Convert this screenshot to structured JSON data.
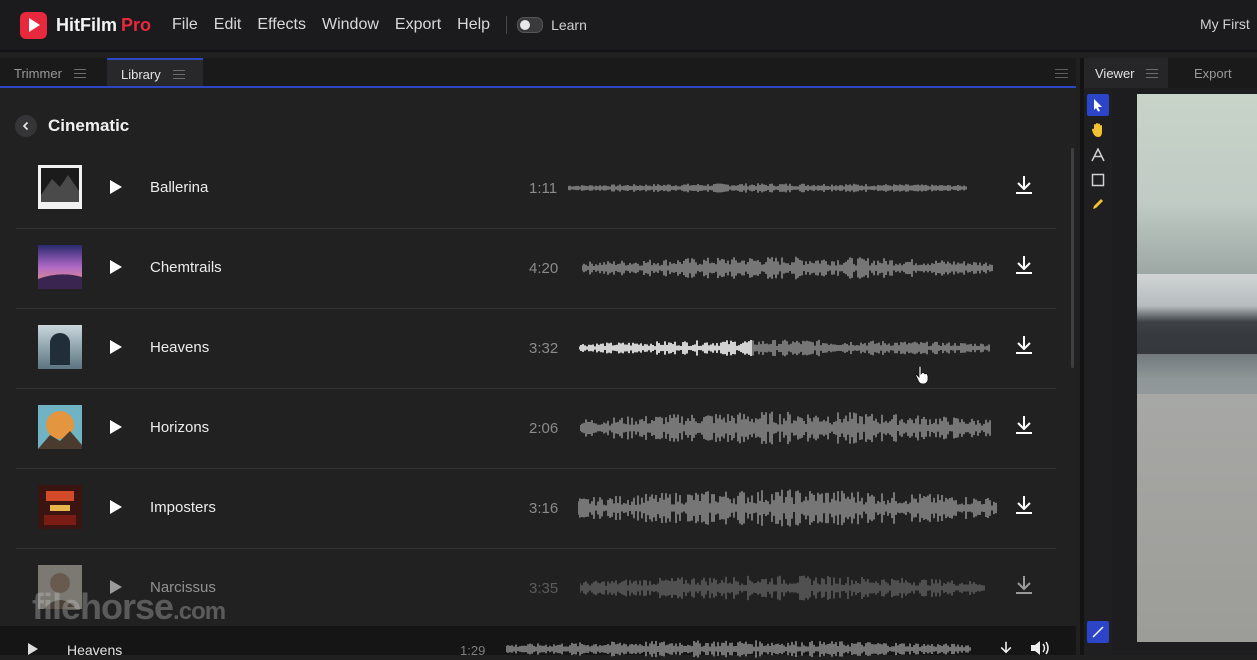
{
  "app": {
    "name": "HitFilm",
    "edition": "Pro",
    "brand_color": "#e8283d",
    "accent_color": "#2c47c4",
    "project_name": "My First"
  },
  "menu": {
    "items": [
      "File",
      "Edit",
      "Effects",
      "Window",
      "Export",
      "Help"
    ],
    "learn_label": "Learn",
    "learn_enabled": false
  },
  "left_panel": {
    "tabs": [
      {
        "label": "Trimmer",
        "active": false
      },
      {
        "label": "Library",
        "active": true
      }
    ],
    "category_title": "Cinematic",
    "tracks": [
      {
        "name": "Ballerina",
        "duration": "1:11",
        "cover": "dark-texture-cover"
      },
      {
        "name": "Chemtrails",
        "duration": "4:20",
        "cover": "purple-sunset-cover"
      },
      {
        "name": "Heavens",
        "duration": "3:32",
        "cover": "arch-portal-cover",
        "playing_progress": 0.42
      },
      {
        "name": "Horizons",
        "duration": "2:06",
        "cover": "moon-mountain-cover"
      },
      {
        "name": "Imposters",
        "duration": "3:16",
        "cover": "red-poster-cover"
      },
      {
        "name": "Narcissus",
        "duration": "3:35",
        "cover": "portrait-cover"
      }
    ]
  },
  "player": {
    "track_name": "Heavens",
    "time": "1:29"
  },
  "right_panel": {
    "tabs": [
      {
        "label": "Viewer",
        "active": true
      },
      {
        "label": "Export",
        "active": false
      }
    ],
    "tools": [
      "select-arrow-icon",
      "hand-icon",
      "text-icon",
      "rectangle-icon",
      "pencil-icon"
    ]
  },
  "watermark": {
    "main": "filehorse",
    "suffix": ".com"
  }
}
